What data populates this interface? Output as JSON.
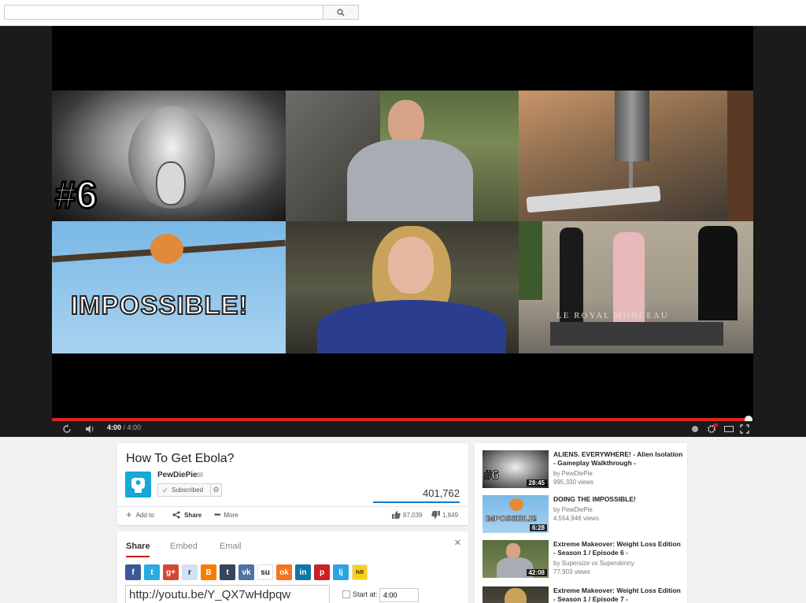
{
  "search": {
    "placeholder": ""
  },
  "player": {
    "current_time": "4:00",
    "duration": "/ 4:00",
    "progress": 1.0,
    "thumb_texts": {
      "hash6": "#6",
      "impossible": "IMPOSSIBLE!",
      "building": "LE ROYAL MONCEAU"
    }
  },
  "video": {
    "title": "How To Get Ebola?",
    "channel": "PewDiePie",
    "subscribe_label": "Subscribed",
    "views": "401,762",
    "add_to_label": "Add to",
    "share_label": "Share",
    "more_label": "More",
    "likes": "87,039",
    "dislikes": "1,849"
  },
  "share_panel": {
    "tabs": [
      "Share",
      "Embed",
      "Email"
    ],
    "active_tab": "Share",
    "url": "http://youtu.be/Y_QX7wHdpqw",
    "start_at_label": "Start at:",
    "start_at_value": "4:00",
    "social": [
      {
        "name": "facebook",
        "color": "#3b5998",
        "glyph": "f"
      },
      {
        "name": "twitter",
        "color": "#2ba9e1",
        "glyph": "t"
      },
      {
        "name": "google-plus",
        "color": "#d34836",
        "glyph": "g+"
      },
      {
        "name": "reddit",
        "color": "#cee3f8",
        "glyph": "r"
      },
      {
        "name": "blogger",
        "color": "#f57d00",
        "glyph": "B"
      },
      {
        "name": "tumblr",
        "color": "#35465c",
        "glyph": "t"
      },
      {
        "name": "vk",
        "color": "#4c75a3",
        "glyph": "vk"
      },
      {
        "name": "stumbleupon",
        "color": "#ffffff",
        "glyph": "su"
      },
      {
        "name": "odnoklassniki",
        "color": "#f4731c",
        "glyph": "ok"
      },
      {
        "name": "linkedin",
        "color": "#0e76a8",
        "glyph": "in"
      },
      {
        "name": "pinterest",
        "color": "#cb2027",
        "glyph": "p"
      },
      {
        "name": "livejournal",
        "color": "#2aa5e2",
        "glyph": "lj"
      },
      {
        "name": "hi5",
        "color": "#fdd017",
        "glyph": "hi5"
      }
    ]
  },
  "related": [
    {
      "title": "ALIENS. EVERYWHERE! - Alien Isolation - Gameplay Walkthrough -",
      "channel": "by PewDiePie",
      "views": "995,330 views",
      "duration": "28:45",
      "thumb_text": "#6"
    },
    {
      "title": "DOING THE IMPOSSIBLE!",
      "channel": "by PewDiePie",
      "views": "4,554,946 views",
      "duration": "6:28",
      "thumb_text": "IMPOSSIBLE!"
    },
    {
      "title": "Extreme Makeover: Weight Loss Edition - Season 1 / Episode 6 -",
      "channel": "by Supersize vs Superskinny",
      "views": "77,903 views",
      "duration": "42:08",
      "thumb_text": ""
    },
    {
      "title": "Extreme Makeover: Weight Loss Edition - Season 1 / Episode 7 -",
      "channel": "",
      "views": "",
      "duration": "",
      "thumb_text": ""
    }
  ],
  "colors": {
    "accent_red": "#cc181e",
    "progress_red": "#d92323",
    "brand_blue": "#167ac6"
  }
}
